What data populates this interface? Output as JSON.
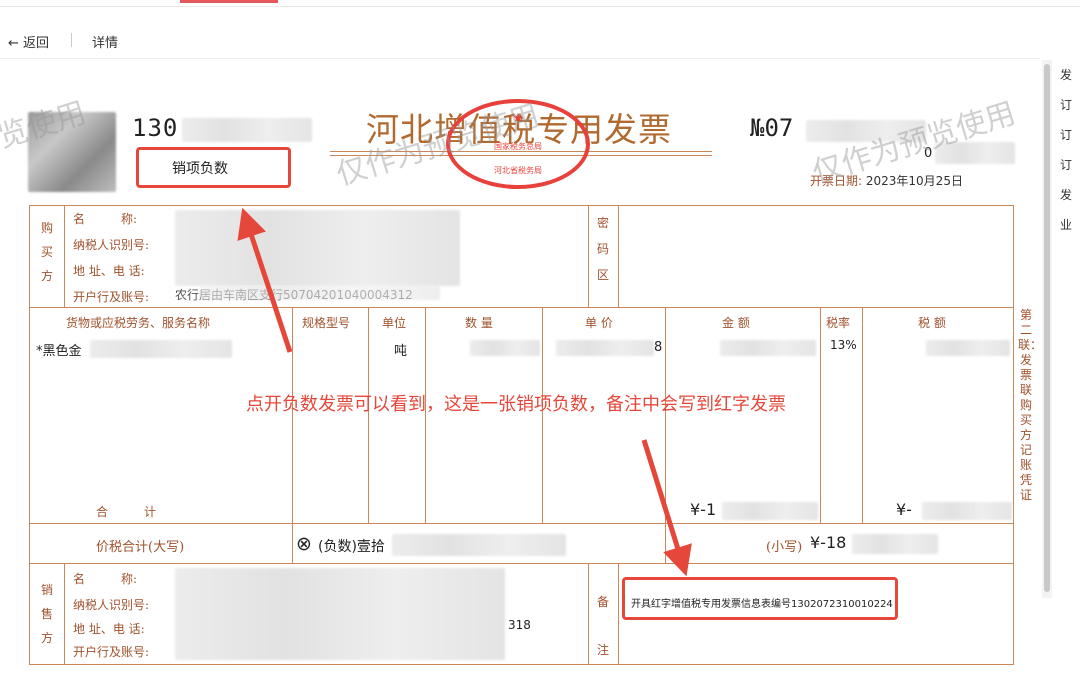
{
  "nav": {
    "back_label": "← 返回",
    "title": "详情"
  },
  "side_panel": {
    "items": [
      "发",
      "订",
      "订",
      "订",
      "发",
      "业"
    ]
  },
  "invoice": {
    "title": "河北增值税专用发票",
    "seal_top": "国家税务总局",
    "seal_bottom": "河北省税务局",
    "code_visible": "130",
    "number_prefix": "№",
    "number_visible": "07",
    "number_second_line": "0",
    "date_label": "开票日期:",
    "date_value": "2023年10月25日",
    "buyer": {
      "section_label": "购买方",
      "name_label": "名　　　称:",
      "tax_id_label": "纳税人识别号:",
      "address_label": "地 址、电 话:",
      "bank_label": "开户行及账号:",
      "bank_partial": "农行居由车南区支行50704201040004312"
    },
    "cipher_label": "密码区",
    "columns": {
      "goods": "货物或应税劳务、服务名称",
      "spec": "规格型号",
      "unit": "单位",
      "qty": "数  量",
      "price": "单  价",
      "amount": "金   额",
      "rate": "税率",
      "tax": "税   额"
    },
    "item": {
      "name_partial": "*黑色金",
      "unit": "吨",
      "price_tail": "8",
      "rate": "13%"
    },
    "total_label": "合　　　计",
    "total_amount_prefix": "¥-1",
    "total_tax_prefix": "¥-",
    "grand_total_label": "价税合计(大写)",
    "grand_total_symbol": "⊗",
    "grand_total_upper": "(负数)壹拾",
    "small_label": "(小写)",
    "small_value_prefix": "¥-18",
    "seller": {
      "section_label": "销售方",
      "name_label": "名　　　称:",
      "tax_id_label": "纳税人识别号:",
      "address_label": "地 址、电 话:",
      "bank_label": "开户行及账号:",
      "address_tail": "318"
    },
    "remark_label": "备注",
    "remark_text": "开具红字增值税专用发票信息表编号1302072310010224",
    "copy_label": "第二联：发票联　购买方记账凭证"
  },
  "annotations": {
    "box_label": "销项负数",
    "main_text": "点开负数发票可以看到，这是一张销项负数，备注中会写到红字发票"
  },
  "watermarks": [
    "览使用",
    "仅作为预览使用",
    "仅作为预览使用"
  ],
  "colors": {
    "accent": "#e5483b",
    "invoice_brown": "#a0522d",
    "seal_red": "#e8403b"
  }
}
